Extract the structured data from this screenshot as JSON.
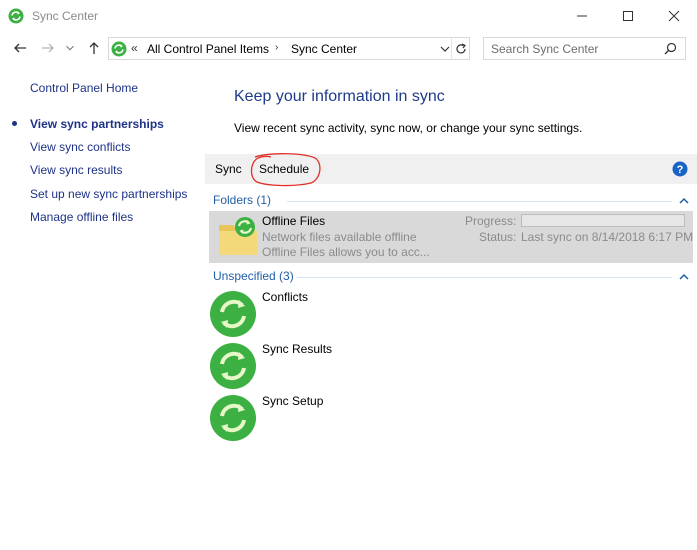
{
  "window": {
    "title": "Sync Center"
  },
  "address": {
    "chevron": "«",
    "crumbs": [
      "All Control Panel Items",
      "Sync Center"
    ],
    "crumb_separator": "›"
  },
  "search": {
    "placeholder": "Search Sync Center"
  },
  "sidebar": {
    "home": "Control Panel Home",
    "items": [
      {
        "label": "View sync partnerships",
        "current": true
      },
      {
        "label": "View sync conflicts"
      },
      {
        "label": "View sync results"
      },
      {
        "label": "Set up new sync partnerships"
      },
      {
        "label": "Manage offline files"
      }
    ]
  },
  "main": {
    "title": "Keep your information in sync",
    "description": "View recent sync activity, sync now, or change your sync settings."
  },
  "toolbar": {
    "sync_label": "Sync",
    "schedule_label": "Schedule",
    "help_label": "?"
  },
  "groups": {
    "folders": {
      "header": "Folders (1)",
      "items": [
        {
          "name": "Offline Files",
          "line1": "Network files available offline",
          "line2": "Offline Files allows you to acc...",
          "progress_label": "Progress:",
          "progress": 0,
          "status_label": "Status:",
          "status": "Last sync on 8/14/2018 6:17 PM"
        }
      ]
    },
    "unspecified": {
      "header": "Unspecified (3)",
      "items": [
        {
          "name": "Conflicts"
        },
        {
          "name": "Sync Results"
        },
        {
          "name": "Sync Setup"
        }
      ]
    }
  },
  "colors": {
    "link": "#1e3287",
    "title": "#1e3b8a",
    "group_header": "#1f5fa8",
    "sync_green": "#3cb043",
    "annotation": "#e0302a"
  },
  "icons": {
    "app": "sync-center-icon",
    "minimize": "minimize-icon",
    "maximize": "maximize-icon",
    "close": "close-icon",
    "back": "back-arrow-icon",
    "forward": "forward-arrow-icon",
    "recent": "recent-locations-icon",
    "up": "up-arrow-icon",
    "refresh": "refresh-icon",
    "search": "search-icon",
    "help": "help-icon"
  }
}
